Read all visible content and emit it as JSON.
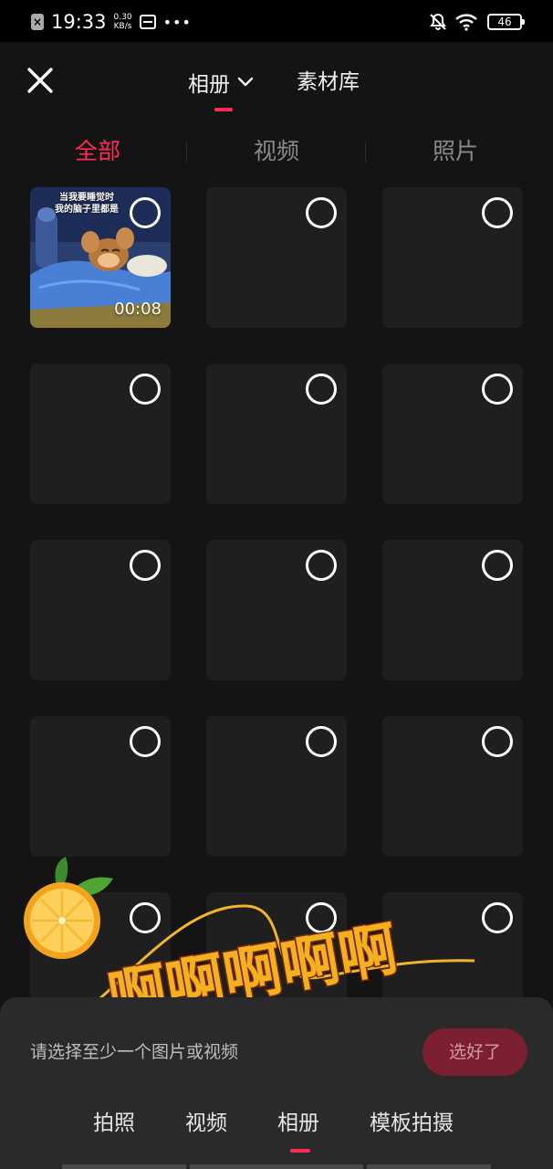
{
  "status_bar": {
    "time": "19:33",
    "speed_value": "0.30",
    "speed_unit": "KB/s",
    "battery": "46",
    "icons": [
      "notification-x-icon",
      "sim-icon",
      "more-dots-icon",
      "bell-muted-icon",
      "wifi-icon",
      "battery-icon"
    ]
  },
  "header": {
    "tabs": [
      {
        "label": "相册",
        "active": true,
        "has_dropdown": true
      },
      {
        "label": "素材库",
        "active": false
      }
    ],
    "accent_color": "#fe2c55"
  },
  "filters": [
    {
      "label": "全部",
      "active": true
    },
    {
      "label": "视频",
      "active": false
    },
    {
      "label": "照片",
      "active": false
    }
  ],
  "grid": {
    "first_item": {
      "type": "video",
      "duration": "00:08",
      "caption_lines": [
        "当我要睡觉时",
        "我的脑子里都是"
      ]
    },
    "placeholder_count": 14
  },
  "sticker": {
    "text": "啊啊啊啊啊"
  },
  "footer": {
    "hint": "请选择至少一个图片或视频",
    "confirm_label": "选好了",
    "confirm_color": "#7c1f30",
    "nav": [
      {
        "label": "拍照",
        "active": false
      },
      {
        "label": "视频",
        "active": false
      },
      {
        "label": "相册",
        "active": true
      },
      {
        "label": "模板拍摄",
        "active": false
      }
    ]
  }
}
